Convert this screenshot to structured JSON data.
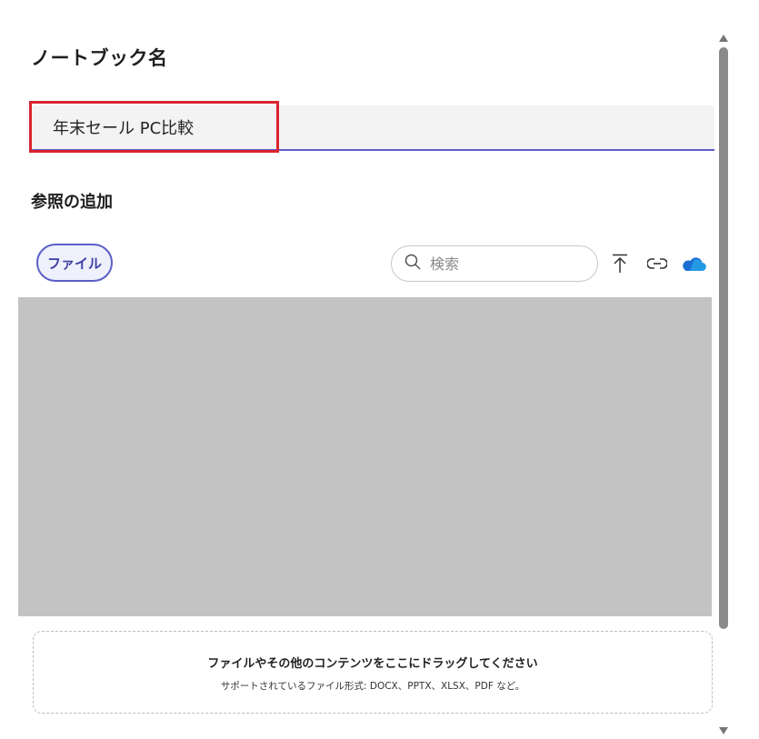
{
  "notebook_name": {
    "title": "ノートブック名",
    "value": "年末セール PC比較"
  },
  "references": {
    "title": "参照の追加",
    "filter_pill": "ファイル",
    "search_placeholder": "検索"
  },
  "dropzone": {
    "title": "ファイルやその他のコンテンツをここにドラッグしてください",
    "subtitle": "サポートされているファイル形式: DOCX、PPTX、XLSX、PDF など。"
  },
  "icons": [
    "upload-icon",
    "link-icon",
    "onedrive-cloud-icon",
    "search-icon"
  ],
  "colors": {
    "accent": "#5b5fc7",
    "highlight": "#d9232e",
    "cloud": "#1a6fd4",
    "preview_bg": "#c3c3c3"
  }
}
